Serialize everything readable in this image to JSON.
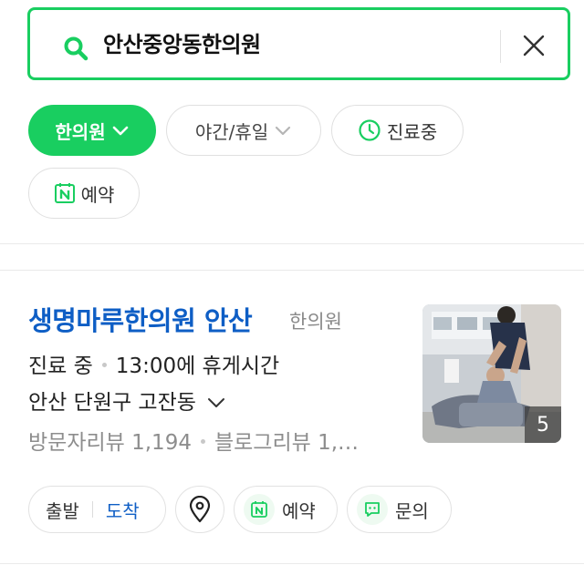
{
  "search": {
    "query": "안산중앙동한의원"
  },
  "filters": [
    {
      "label": "한의원"
    },
    {
      "label": "야간/휴일"
    },
    {
      "label": "진료중"
    },
    {
      "label": "예약"
    }
  ],
  "result": {
    "name": "생명마루한의원 안산",
    "category": "한의원",
    "status": "진료 중",
    "break_info": "13:00에 휴게시간",
    "address": "안산 단원구 고잔동",
    "visitor_reviews": "방문자리뷰 1,194",
    "blog_reviews": "블로그리뷰 1,…",
    "photo_count": "5"
  },
  "actions": {
    "depart": "출발",
    "arrive": "도착",
    "book": "예약",
    "ask": "문의"
  },
  "colors": {
    "accent_green": "#19ce60",
    "link_blue": "#0e5ec5"
  }
}
